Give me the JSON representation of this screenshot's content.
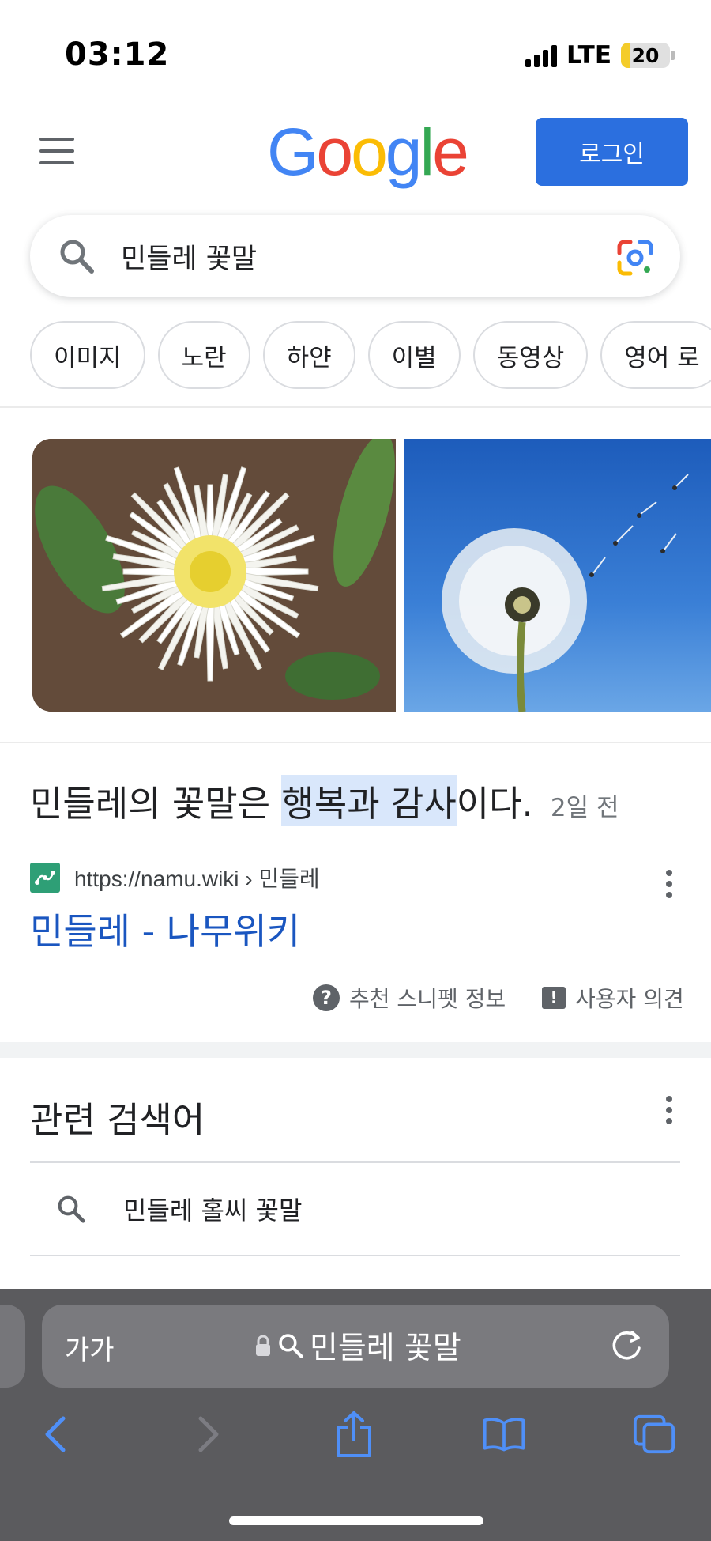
{
  "status_bar": {
    "time": "03:12",
    "network": "LTE",
    "battery": "20",
    "battery_level": 0.2,
    "battery_color": "#f4cc2a"
  },
  "header": {
    "menu_icon": "hamburger-menu-icon",
    "logo": {
      "letters": [
        "G",
        "o",
        "o",
        "g",
        "l",
        "e"
      ],
      "colors": [
        "#4285F4",
        "#EA4335",
        "#FBBC05",
        "#4285F4",
        "#34A853",
        "#EA4335"
      ]
    },
    "login_label": "로그인",
    "login_color": "#2b6fdf"
  },
  "search": {
    "query": "민들레 꽃말",
    "search_icon": "search-icon",
    "lens_icon": "google-lens-icon"
  },
  "chips": [
    "이미지",
    "노란",
    "하얀",
    "이별",
    "동영상",
    "영어 로"
  ],
  "images": [
    {
      "alt_icon": "white-dandelion-photo"
    },
    {
      "alt_icon": "dandelion-seedhead-sky-photo"
    }
  ],
  "featured_snippet": {
    "answer_before": "민들레의 꽃말은 ",
    "answer_highlight": "행복과 감사",
    "answer_after": "이다.",
    "date": "2일 전",
    "source_url": "https://namu.wiki",
    "source_breadcrumb": " › 민들레",
    "result_title": "민들레 - 나무위키",
    "snippet_info_label": "추천 스니펫 정보",
    "feedback_label": "사용자 의견"
  },
  "related": {
    "title": "관련 검색어",
    "items": [
      "민들레 홀씨 꽃말"
    ]
  },
  "safari": {
    "text_size_label": "가가",
    "address": "민들레 꽃말",
    "icons": [
      "lock-icon",
      "search-icon",
      "reload-icon"
    ],
    "toolbar": [
      "back-icon",
      "forward-icon",
      "share-icon",
      "bookmarks-icon",
      "tabs-icon"
    ]
  }
}
